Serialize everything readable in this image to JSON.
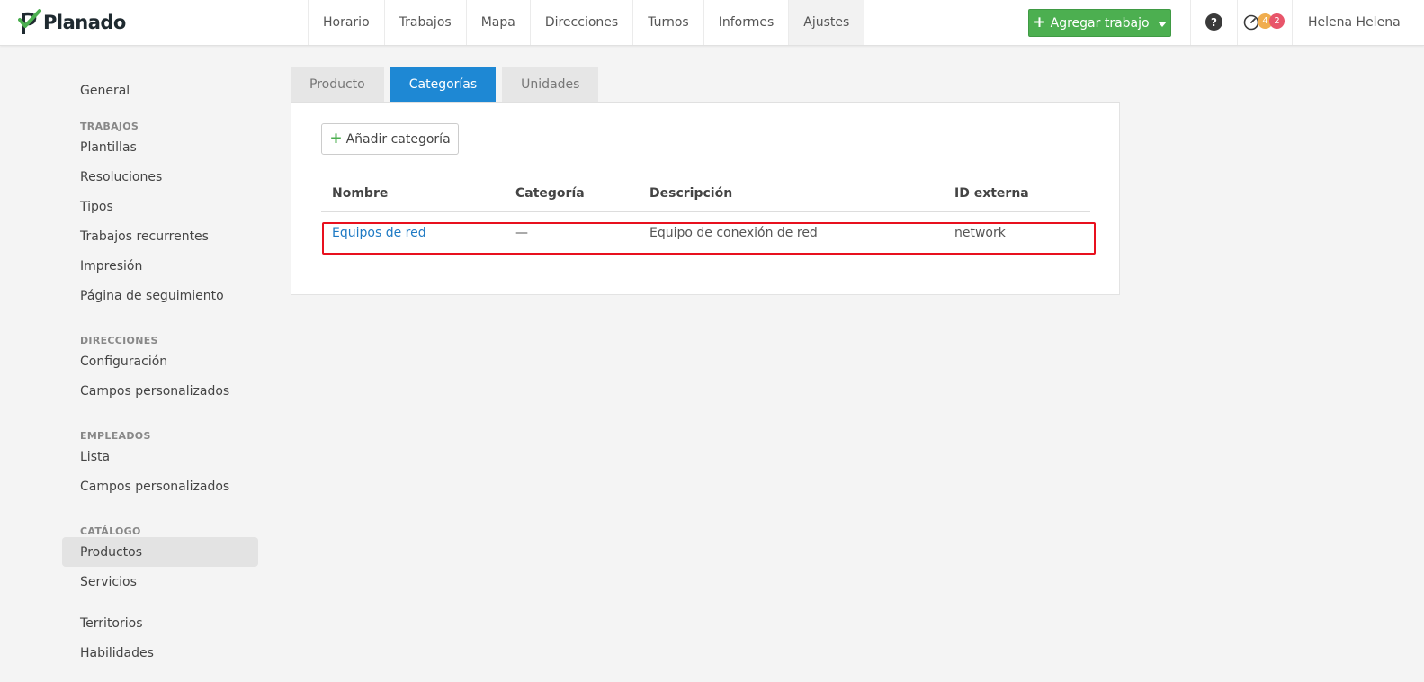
{
  "app": {
    "logo_text": "Planado"
  },
  "nav": {
    "items": [
      {
        "label": "Horario"
      },
      {
        "label": "Trabajos"
      },
      {
        "label": "Mapa"
      },
      {
        "label": "Direcciones"
      },
      {
        "label": "Turnos"
      },
      {
        "label": "Informes"
      },
      {
        "label": "Ajustes",
        "active": true
      }
    ],
    "add_job_label": "Agregar trabajo",
    "help_icon_glyph": "?",
    "badge_orange": "4",
    "badge_red": "2",
    "user_name": "Helena Helena",
    "colors": {
      "primary_green": "#4caf50",
      "badge_orange": "#f0ad4e",
      "badge_red": "#e8556a",
      "tab_active_blue": "#1e88d4"
    }
  },
  "sidebar": {
    "general": "General",
    "sections": [
      {
        "title": "TRABAJOS",
        "items": [
          "Plantillas",
          "Resoluciones",
          "Tipos",
          "Trabajos recurrentes",
          "Impresión",
          "Página de seguimiento"
        ]
      },
      {
        "title": "DIRECCIONES",
        "items": [
          "Configuración",
          "Campos personalizados"
        ]
      },
      {
        "title": "EMPLEADOS",
        "items": [
          "Lista",
          "Campos personalizados"
        ]
      },
      {
        "title": "CATÁLOGO",
        "items": [
          "Productos",
          "Servicios"
        ]
      }
    ],
    "extra": [
      "Territorios",
      "Habilidades"
    ],
    "active": "Productos"
  },
  "tabs": [
    {
      "label": "Producto"
    },
    {
      "label": "Categorías",
      "active": true
    },
    {
      "label": "Unidades"
    }
  ],
  "panel": {
    "add_button_label": "Añadir categoría",
    "columns": [
      "Nombre",
      "Categoría",
      "Descripción",
      "ID externa"
    ],
    "rows": [
      {
        "name": "Equipos de red",
        "category": "—",
        "description": "Equipo de conexión de red",
        "external_id": "network"
      }
    ]
  }
}
